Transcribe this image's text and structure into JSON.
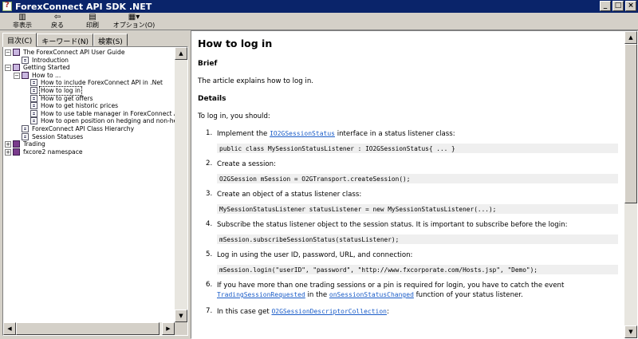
{
  "window": {
    "title": "ForexConnect API SDK .NET"
  },
  "toolbar": {
    "hide": "非表示",
    "back": "戻る",
    "print": "印刷",
    "options": "オプション(O)"
  },
  "tabs": [
    "目次(C)",
    "キーワード(N)",
    "検索(S)"
  ],
  "tree": [
    {
      "label": "The ForexConnect API User Guide",
      "level": 0,
      "kind": "open",
      "pm": "−"
    },
    {
      "label": "Introduction",
      "level": 1,
      "kind": "page"
    },
    {
      "label": "Getting Started",
      "level": 0,
      "kind": "open",
      "pm": "−"
    },
    {
      "label": "How to ...",
      "level": 1,
      "kind": "open",
      "pm": "−"
    },
    {
      "label": "How to include ForexConnect API in .Net",
      "level": 2,
      "kind": "page"
    },
    {
      "label": "How to log in",
      "level": 2,
      "kind": "page",
      "selected": true
    },
    {
      "label": "How to get offers",
      "level": 2,
      "kind": "page"
    },
    {
      "label": "How to get historic prices",
      "level": 2,
      "kind": "page"
    },
    {
      "label": "How to use table manager in ForexConnect API",
      "level": 2,
      "kind": "page"
    },
    {
      "label": "How to open position on hedging and non-hedging accou",
      "level": 2,
      "kind": "page"
    },
    {
      "label": "ForexConnect API Class Hierarchy",
      "level": 1,
      "kind": "page"
    },
    {
      "label": "Session Statuses",
      "level": 1,
      "kind": "page"
    },
    {
      "label": "Trading",
      "level": 0,
      "kind": "book",
      "pm": "+"
    },
    {
      "label": "fxcore2 namespace",
      "level": 0,
      "kind": "book",
      "pm": "+"
    }
  ],
  "content": {
    "title": "How to log in",
    "brief_heading": "Brief",
    "brief_text": "The article explains how to log in.",
    "details_heading": "Details",
    "intro": "To log in, you should:",
    "steps": [
      {
        "num": "1.",
        "parts": [
          "Implement the ",
          {
            "link": "IO2GSessionStatus"
          },
          " interface in a status listener class:"
        ],
        "code": "public class MySessionStatusListener : IO2GSessionStatus{ ... }"
      },
      {
        "num": "2.",
        "parts": [
          "Create a session:"
        ],
        "code": "O2GSession mSession = O2GTransport.createSession();"
      },
      {
        "num": "3.",
        "parts": [
          "Create an object of a status listener class:"
        ],
        "code": "MySessionStatusListener statusListener = new MySessionStatusListener(...);"
      },
      {
        "num": "4.",
        "parts": [
          "Subscribe the status listener object to the session status. It is important to subscribe before the login:"
        ],
        "code": "mSession.subscribeSessionStatus(statusListener);"
      },
      {
        "num": "5.",
        "parts": [
          "Log in using the user ID, password, URL, and connection:"
        ],
        "code": "mSession.login(\"userID\", \"password\", \"http://www.fxcorporate.com/Hosts.jsp\", \"Demo\");"
      },
      {
        "num": "6.",
        "parts": [
          "If you have more than one trading sessions or a pin is required for login, you have to catch the event ",
          {
            "link": "TradingSessionRequested"
          },
          " in the ",
          {
            "link": "onSessionStatusChanged"
          },
          " function of your status listener."
        ],
        "code": null
      },
      {
        "num": "7.",
        "parts": [
          "In this case get ",
          {
            "link": "O2GSessionDescriptorCollection"
          },
          ":"
        ],
        "code": null
      }
    ]
  },
  "colors": {
    "titlebar": "#0a246a",
    "link": "#1a5cc8",
    "code_bg": "#efefef"
  }
}
